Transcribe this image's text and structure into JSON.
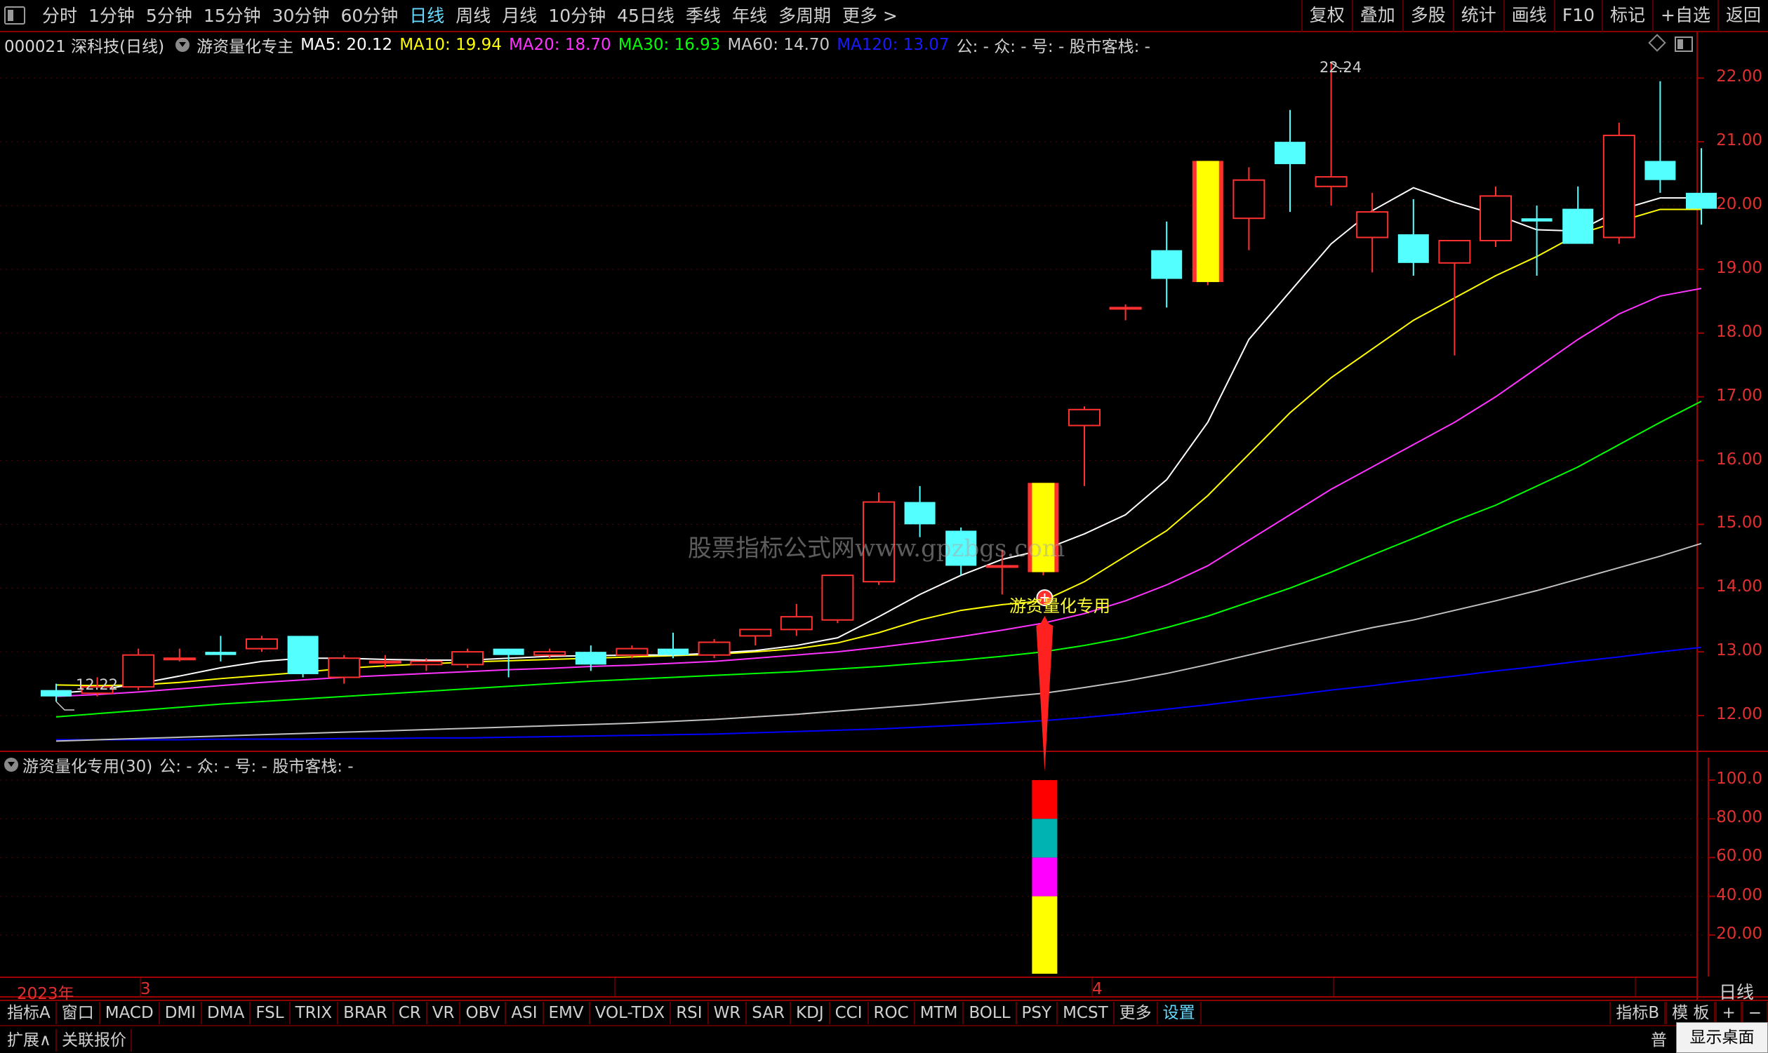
{
  "toolbar": {
    "periods": [
      "分时",
      "1分钟",
      "5分钟",
      "15分钟",
      "30分钟",
      "60分钟",
      "日线",
      "周线",
      "月线",
      "10分钟",
      "45日线",
      "季线",
      "年线",
      "多周期",
      "更多 >"
    ],
    "active_period": "日线",
    "right_buttons": [
      "复权",
      "叠加",
      "多股",
      "统计",
      "画线",
      "F10",
      "标记",
      "+自选",
      "返回"
    ]
  },
  "info": {
    "stock": "000021 深科技(日线)",
    "formula": "游资量化专主",
    "ma5": "MA5: 20.12",
    "ma10": "MA10: 19.94",
    "ma20": "MA20: 18.70",
    "ma30": "MA30: 16.93",
    "ma60": "MA60: 14.70",
    "ma120": "MA120: 13.07",
    "extra": "公: - 众: - 号: - 股市客栈: -"
  },
  "colors": {
    "ma5": "#ffffff",
    "ma10": "#ffff00",
    "ma20": "#ff33ff",
    "ma30": "#00ff00",
    "ma60": "#c0c0c0",
    "ma120": "#0000ff",
    "up": "#ff3030",
    "down": "#54ffff",
    "signal": "#ffff00",
    "axis": "#a00000"
  },
  "chart": {
    "watermark": "股票指标公式网www.gpzbgs.com",
    "signal_label": "游资量化专用",
    "high_label": "22.24",
    "low_label": "12.22",
    "price_ticks": [
      "22.00",
      "21.00",
      "20.00",
      "19.00",
      "18.00",
      "17.00",
      "16.00",
      "15.00",
      "14.00",
      "13.00",
      "12.00"
    ],
    "sub_ticks": [
      "100.0",
      "80.00",
      "60.00",
      "40.00",
      "20.00"
    ],
    "sub_title": "游资量化专用(30)",
    "sub_extra": "公: - 众: - 号: - 股市客栈: -",
    "date_labels": [
      "2023年",
      "3",
      "4"
    ],
    "cycle": "日线"
  },
  "chart_data": {
    "type": "candlestick",
    "candles": [
      {
        "o": 12.4,
        "h": 12.5,
        "l": 12.22,
        "c": 12.3
      },
      {
        "o": 12.35,
        "h": 12.6,
        "l": 12.3,
        "c": 12.45
      },
      {
        "o": 12.45,
        "h": 13.05,
        "l": 12.4,
        "c": 12.95
      },
      {
        "o": 12.9,
        "h": 13.05,
        "l": 12.85,
        "c": 12.9
      },
      {
        "o": 13.0,
        "h": 13.25,
        "l": 12.85,
        "c": 12.95
      },
      {
        "o": 13.05,
        "h": 13.25,
        "l": 13.0,
        "c": 13.2
      },
      {
        "o": 13.25,
        "h": 13.25,
        "l": 12.6,
        "c": 12.65
      },
      {
        "o": 12.6,
        "h": 12.95,
        "l": 12.5,
        "c": 12.9
      },
      {
        "o": 12.85,
        "h": 12.95,
        "l": 12.75,
        "c": 12.85
      },
      {
        "o": 12.8,
        "h": 12.9,
        "l": 12.7,
        "c": 12.85
      },
      {
        "o": 12.8,
        "h": 13.05,
        "l": 12.75,
        "c": 13.0
      },
      {
        "o": 13.05,
        "h": 13.05,
        "l": 12.6,
        "c": 12.95
      },
      {
        "o": 12.95,
        "h": 13.05,
        "l": 12.9,
        "c": 13.0
      },
      {
        "o": 13.0,
        "h": 13.1,
        "l": 12.7,
        "c": 12.8
      },
      {
        "o": 12.95,
        "h": 13.1,
        "l": 12.9,
        "c": 13.05
      },
      {
        "o": 13.05,
        "h": 13.3,
        "l": 12.9,
        "c": 12.95
      },
      {
        "o": 12.95,
        "h": 13.2,
        "l": 12.9,
        "c": 13.15
      },
      {
        "o": 13.25,
        "h": 13.35,
        "l": 13.1,
        "c": 13.35
      },
      {
        "o": 13.35,
        "h": 13.75,
        "l": 13.25,
        "c": 13.55
      },
      {
        "o": 13.5,
        "h": 14.2,
        "l": 13.45,
        "c": 14.2
      },
      {
        "o": 14.1,
        "h": 15.5,
        "l": 14.05,
        "c": 15.35
      },
      {
        "o": 15.35,
        "h": 15.6,
        "l": 14.8,
        "c": 15.0
      },
      {
        "o": 14.9,
        "h": 14.95,
        "l": 14.2,
        "c": 14.35
      },
      {
        "o": 14.35,
        "h": 14.6,
        "l": 13.9,
        "c": 14.35
      },
      {
        "o": 14.25,
        "h": 15.65,
        "l": 14.2,
        "c": 15.65,
        "signal": true
      },
      {
        "o": 16.55,
        "h": 16.85,
        "l": 15.6,
        "c": 16.8
      },
      {
        "o": 18.4,
        "h": 18.45,
        "l": 18.2,
        "c": 18.4
      },
      {
        "o": 19.3,
        "h": 19.75,
        "l": 18.4,
        "c": 18.85
      },
      {
        "o": 18.8,
        "h": 20.7,
        "l": 18.75,
        "c": 20.7,
        "signal": true
      },
      {
        "o": 19.8,
        "h": 20.6,
        "l": 19.3,
        "c": 20.4
      },
      {
        "o": 21.0,
        "h": 21.5,
        "l": 19.9,
        "c": 20.65
      },
      {
        "o": 20.3,
        "h": 22.24,
        "l": 20.0,
        "c": 20.45
      },
      {
        "o": 19.5,
        "h": 20.2,
        "l": 18.95,
        "c": 19.9
      },
      {
        "o": 19.55,
        "h": 20.1,
        "l": 18.9,
        "c": 19.1
      },
      {
        "o": 19.1,
        "h": 19.45,
        "l": 17.65,
        "c": 19.45
      },
      {
        "o": 19.45,
        "h": 20.3,
        "l": 19.35,
        "c": 20.15
      },
      {
        "o": 19.8,
        "h": 20.0,
        "l": 18.9,
        "c": 19.75
      },
      {
        "o": 19.95,
        "h": 20.3,
        "l": 19.4,
        "c": 19.4
      },
      {
        "o": 19.5,
        "h": 21.3,
        "l": 19.4,
        "c": 21.1
      },
      {
        "o": 20.7,
        "h": 21.95,
        "l": 20.2,
        "c": 20.4
      },
      {
        "o": 20.2,
        "h": 20.9,
        "l": 19.7,
        "c": 19.95
      }
    ],
    "ma5": [
      12.35,
      12.4,
      12.5,
      12.62,
      12.75,
      12.85,
      12.9,
      12.9,
      12.88,
      12.87,
      12.87,
      12.9,
      12.93,
      12.94,
      12.95,
      12.95,
      12.98,
      13.02,
      13.1,
      13.22,
      13.55,
      13.9,
      14.2,
      14.45,
      14.6,
      14.85,
      15.15,
      15.7,
      16.6,
      17.9,
      18.65,
      19.4,
      19.92,
      20.28,
      20.05,
      19.86,
      19.62,
      19.6,
      19.93,
      20.12,
      20.12
    ],
    "ma10": [
      12.48,
      12.47,
      12.48,
      12.52,
      12.58,
      12.63,
      12.68,
      12.74,
      12.78,
      12.81,
      12.84,
      12.86,
      12.88,
      12.9,
      12.92,
      12.94,
      12.96,
      13.0,
      13.05,
      13.14,
      13.3,
      13.5,
      13.65,
      13.74,
      13.8,
      14.1,
      14.5,
      14.9,
      15.45,
      16.1,
      16.75,
      17.3,
      17.75,
      18.2,
      18.55,
      18.9,
      19.2,
      19.55,
      19.75,
      19.94,
      19.94
    ],
    "ma20": [
      12.3,
      12.33,
      12.37,
      12.42,
      12.47,
      12.52,
      12.56,
      12.6,
      12.63,
      12.66,
      12.69,
      12.72,
      12.74,
      12.77,
      12.79,
      12.82,
      12.85,
      12.9,
      12.95,
      13.0,
      13.07,
      13.15,
      13.24,
      13.34,
      13.45,
      13.6,
      13.8,
      14.05,
      14.35,
      14.75,
      15.15,
      15.55,
      15.9,
      16.25,
      16.6,
      17.0,
      17.45,
      17.9,
      18.3,
      18.58,
      18.7
    ],
    "ma30": [
      11.98,
      12.03,
      12.08,
      12.13,
      12.18,
      12.22,
      12.26,
      12.3,
      12.34,
      12.38,
      12.42,
      12.46,
      12.5,
      12.54,
      12.57,
      12.6,
      12.63,
      12.66,
      12.69,
      12.73,
      12.77,
      12.82,
      12.87,
      12.93,
      13.0,
      13.1,
      13.22,
      13.38,
      13.56,
      13.78,
      14.0,
      14.25,
      14.52,
      14.78,
      15.05,
      15.3,
      15.6,
      15.9,
      16.25,
      16.6,
      16.93
    ],
    "ma60": [
      11.6,
      11.62,
      11.64,
      11.66,
      11.68,
      11.7,
      11.72,
      11.74,
      11.76,
      11.78,
      11.8,
      11.82,
      11.84,
      11.86,
      11.88,
      11.91,
      11.94,
      11.98,
      12.02,
      12.07,
      12.12,
      12.17,
      12.23,
      12.29,
      12.35,
      12.44,
      12.54,
      12.66,
      12.8,
      12.95,
      13.1,
      13.24,
      13.38,
      13.5,
      13.65,
      13.8,
      13.96,
      14.14,
      14.32,
      14.5,
      14.7
    ],
    "ma120": [
      11.62,
      11.62,
      11.62,
      11.62,
      11.63,
      11.63,
      11.63,
      11.64,
      11.64,
      11.65,
      11.65,
      11.66,
      11.67,
      11.68,
      11.69,
      11.7,
      11.71,
      11.73,
      11.75,
      11.77,
      11.79,
      11.82,
      11.85,
      11.88,
      11.92,
      11.97,
      12.03,
      12.1,
      12.17,
      12.25,
      12.32,
      12.4,
      12.47,
      12.55,
      12.62,
      12.7,
      12.77,
      12.85,
      12.92,
      13.0,
      13.07
    ],
    "sub_signal": {
      "index": 24,
      "segments": [
        {
          "from": 80,
          "to": 100,
          "color": "#ff0000"
        },
        {
          "from": 60,
          "to": 80,
          "color": "#00b3b3"
        },
        {
          "from": 40,
          "to": 60,
          "color": "#ff00ff"
        },
        {
          "from": 0,
          "to": 40,
          "color": "#ffff00"
        }
      ]
    },
    "price_range": [
      11.45,
      22.3
    ],
    "sub_range": [
      0,
      100
    ]
  },
  "indicators": {
    "left_label": "指标A",
    "items": [
      "窗口",
      "MACD",
      "DMI",
      "DMA",
      "FSL",
      "TRIX",
      "BRAR",
      "CR",
      "VR",
      "OBV",
      "ASI",
      "EMV",
      "VOL-TDX",
      "RSI",
      "WR",
      "SAR",
      "KDJ",
      "CCI",
      "ROC",
      "MTM",
      "BOLL",
      "PSY",
      "MCST",
      "更多",
      "设置"
    ],
    "highlight": "设置",
    "right": [
      "指标B",
      "模 板",
      "+",
      "−"
    ]
  },
  "status": {
    "expand": "扩展∧",
    "quote": "关联报价",
    "right_text": "普",
    "desktop_tip": "显示桌面"
  }
}
